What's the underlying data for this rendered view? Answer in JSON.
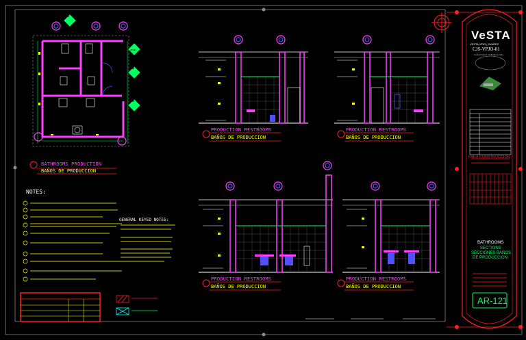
{
  "sheet": {
    "title_en": "PRODUCTION RESTROOMS",
    "title_es": "BAÑOS DE PRODUCCION",
    "plan_title_en": "BATHROOMS PRODUCTION",
    "plan_title_es": "BAÑOS DE PRODUCCION",
    "notes_heading": "NOTES:",
    "keyed_notes_heading": "GENERAL KEYED NOTES:",
    "plan_tags": [
      "A",
      "B",
      "C"
    ],
    "plan_tag_sheet": "AR121",
    "grid_marks": [
      "7",
      "8",
      "9"
    ]
  },
  "title_block": {
    "brand": "VeSTA",
    "brand_tag": "VESTA VPIO | JUAREZ",
    "project_code": "CJS-VPJO-01",
    "address_line": "Ciudad Juárez, Chihuahua, Méx.",
    "construction_label": "PARA CONSTRUCCION",
    "sheet_name_1": "BATHROOMS",
    "sheet_name_2": "SECTIONS",
    "sheet_name_3": "SECCIONES BAÑOS",
    "sheet_name_4": "DE PRODUCCION",
    "sheet_number": "AR-121"
  },
  "colors": {
    "background": "#000000",
    "wall_magenta": "#ff40ff",
    "accent_yellow": "#ffff00",
    "accent_green": "#00ff60",
    "accent_red": "#ff2020",
    "marker_blue": "#5050ff",
    "border_gray": "#8c8c8c"
  },
  "icons": [
    "north-arrow-icon",
    "grid-bubble-icon",
    "section-tag-icon",
    "company-logo-icon"
  ]
}
